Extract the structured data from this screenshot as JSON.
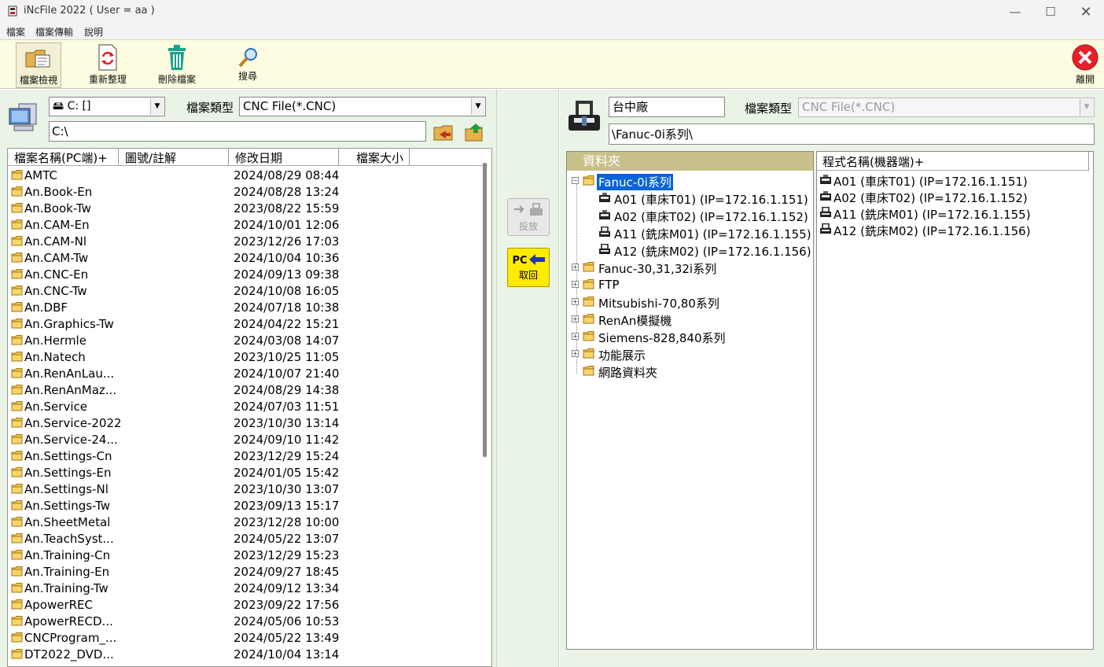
{
  "window": {
    "title": "iNcFile 2022 ( User = aa )",
    "minimize": "—",
    "maximize": "☐",
    "close": "✕"
  },
  "menu": [
    "檔案",
    "檔案傳輸",
    "說明"
  ],
  "toolbar": {
    "view_label": "檔案檢視",
    "refresh_label": "重新整理",
    "delete_label": "刪除檔案",
    "search_label": "搜尋",
    "exit_label": "離開"
  },
  "left": {
    "drive": "C: []",
    "type_label": "檔案類型",
    "type_value": "CNC File(*.CNC)",
    "path": "C:\\",
    "columns": [
      "檔案名稱(PC端)+",
      "圖號/註解",
      "修改日期",
      "檔案大小"
    ],
    "files": [
      {
        "name": "AMTC",
        "date": "2024/08/29 08:44"
      },
      {
        "name": "An.Book-En",
        "date": "2024/08/28 13:24"
      },
      {
        "name": "An.Book-Tw",
        "date": "2023/08/22 15:59"
      },
      {
        "name": "An.CAM-En",
        "date": "2024/10/01 12:06"
      },
      {
        "name": "An.CAM-Nl",
        "date": "2023/12/26 17:03"
      },
      {
        "name": "An.CAM-Tw",
        "date": "2024/10/04 10:36"
      },
      {
        "name": "An.CNC-En",
        "date": "2024/09/13 09:38"
      },
      {
        "name": "An.CNC-Tw",
        "date": "2024/10/08 16:05"
      },
      {
        "name": "An.DBF",
        "date": "2024/07/18 10:38"
      },
      {
        "name": "An.Graphics-Tw",
        "date": "2024/04/22 15:21"
      },
      {
        "name": "An.Hermle",
        "date": "2024/03/08 14:07"
      },
      {
        "name": "An.Natech",
        "date": "2023/10/25 11:05"
      },
      {
        "name": "An.RenAnLau...",
        "date": "2024/10/07 21:40"
      },
      {
        "name": "An.RenAnMaz...",
        "date": "2024/08/29 14:38"
      },
      {
        "name": "An.Service",
        "date": "2024/07/03 11:51"
      },
      {
        "name": "An.Service-2022",
        "date": "2023/10/30 13:14"
      },
      {
        "name": "An.Service-24...",
        "date": "2024/09/10 11:42"
      },
      {
        "name": "An.Settings-Cn",
        "date": "2023/12/29 15:24"
      },
      {
        "name": "An.Settings-En",
        "date": "2024/01/05 15:42"
      },
      {
        "name": "An.Settings-Nl",
        "date": "2023/10/30 13:07"
      },
      {
        "name": "An.Settings-Tw",
        "date": "2023/09/13 15:17"
      },
      {
        "name": "An.SheetMetal",
        "date": "2023/12/28 10:00"
      },
      {
        "name": "An.TeachSyst...",
        "date": "2024/05/22 13:07"
      },
      {
        "name": "An.Training-Cn",
        "date": "2023/12/29 15:23"
      },
      {
        "name": "An.Training-En",
        "date": "2024/09/27 18:45"
      },
      {
        "name": "An.Training-Tw",
        "date": "2024/09/12 13:34"
      },
      {
        "name": "ApowerREC",
        "date": "2023/09/22 17:56"
      },
      {
        "name": "ApowerRECD...",
        "date": "2024/05/06 10:53"
      },
      {
        "name": "CNCProgram_...",
        "date": "2024/05/22 13:49"
      },
      {
        "name": "DT2022_DVD...",
        "date": "2024/10/04 13:14"
      }
    ]
  },
  "middle": {
    "send_label": "投放",
    "receive_pc": "PC",
    "receive_label": "取回"
  },
  "right": {
    "factory": "台中廠",
    "type_label": "檔案類型",
    "type_value": "CNC File(*.CNC)",
    "path": "\\Fanuc-0i系列\\",
    "folder_header": "資料夾",
    "program_header": "程式名稱(機器端)+",
    "tree": [
      {
        "label": "Fanuc-0i系列",
        "level": 0,
        "expander": "−",
        "kind": "folder",
        "selected": true
      },
      {
        "label": "A01 (車床T01) (IP=172.16.1.151)",
        "level": 1,
        "kind": "lathe"
      },
      {
        "label": "A02 (車床T02) (IP=172.16.1.152)",
        "level": 1,
        "kind": "lathe"
      },
      {
        "label": "A11 (銑床M01) (IP=172.16.1.155)",
        "level": 1,
        "kind": "mill"
      },
      {
        "label": "A12 (銑床M02) (IP=172.16.1.156)",
        "level": 1,
        "kind": "mill"
      },
      {
        "label": "Fanuc-30,31,32i系列",
        "level": 0,
        "expander": "+",
        "kind": "folder"
      },
      {
        "label": "FTP",
        "level": 0,
        "expander": "+",
        "kind": "folder"
      },
      {
        "label": "Mitsubishi-70,80系列",
        "level": 0,
        "expander": "+",
        "kind": "folder"
      },
      {
        "label": "RenAn模擬機",
        "level": 0,
        "expander": "+",
        "kind": "folder"
      },
      {
        "label": "Siemens-828,840系列",
        "level": 0,
        "expander": "+",
        "kind": "folder"
      },
      {
        "label": "功能展示",
        "level": 0,
        "expander": "+",
        "kind": "folder"
      },
      {
        "label": "網路資料夾",
        "level": 0,
        "kind": "folder"
      }
    ],
    "programs": [
      {
        "label": "A01 (車床T01) (IP=172.16.1.151)",
        "kind": "lathe"
      },
      {
        "label": "A02 (車床T02) (IP=172.16.1.152)",
        "kind": "lathe"
      },
      {
        "label": "A11 (銑床M01) (IP=172.16.1.155)",
        "kind": "mill"
      },
      {
        "label": "A12 (銑床M02) (IP=172.16.1.156)",
        "kind": "mill"
      }
    ]
  },
  "colors": {
    "toolbar_bg": "#fdfbe0",
    "pane_bg": "#e9f3e6",
    "folder_header_bg": "#c8c08a",
    "selection": "#0a64d8",
    "receive_button": "#ffea00",
    "exit_red": "#e8202a"
  }
}
